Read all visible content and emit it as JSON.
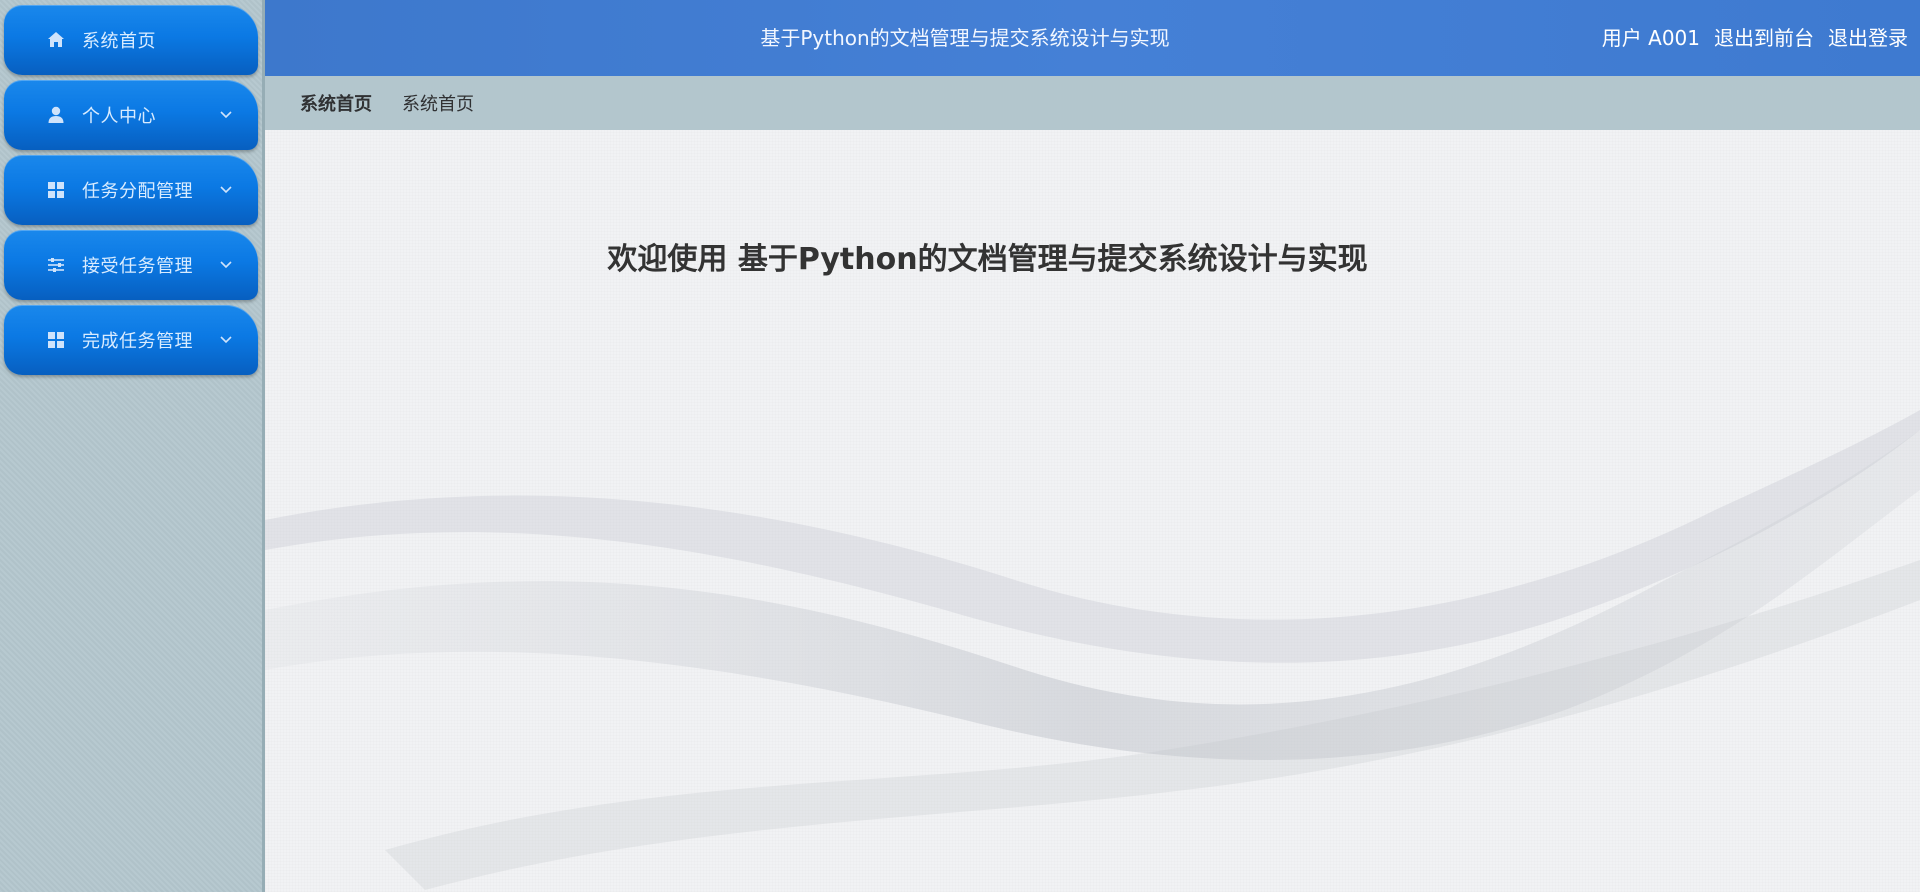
{
  "sidebar": {
    "items": [
      {
        "label": "系统首页",
        "icon": "home-icon",
        "has_submenu": false
      },
      {
        "label": "个人中心",
        "icon": "user-icon",
        "has_submenu": true
      },
      {
        "label": "任务分配管理",
        "icon": "grid-icon",
        "has_submenu": true
      },
      {
        "label": "接受任务管理",
        "icon": "sliders-icon",
        "has_submenu": true
      },
      {
        "label": "完成任务管理",
        "icon": "grid-icon",
        "has_submenu": true
      }
    ]
  },
  "header": {
    "title": "基于Python的文档管理与提交系统设计与实现",
    "user_label": "用户",
    "user_name": "A001",
    "exit_front": "退出到前台",
    "logout": "退出登录"
  },
  "breadcrumb": {
    "current": "系统首页",
    "items": [
      "系统首页"
    ]
  },
  "main": {
    "welcome": "欢迎使用 基于Python的文档管理与提交系统设计与实现"
  },
  "colors": {
    "sidebar_bg": "#b3c6cd",
    "menu_blue": "#0b79e4",
    "header_blue": "#4580d6",
    "content_bg": "#f1f2f4"
  }
}
